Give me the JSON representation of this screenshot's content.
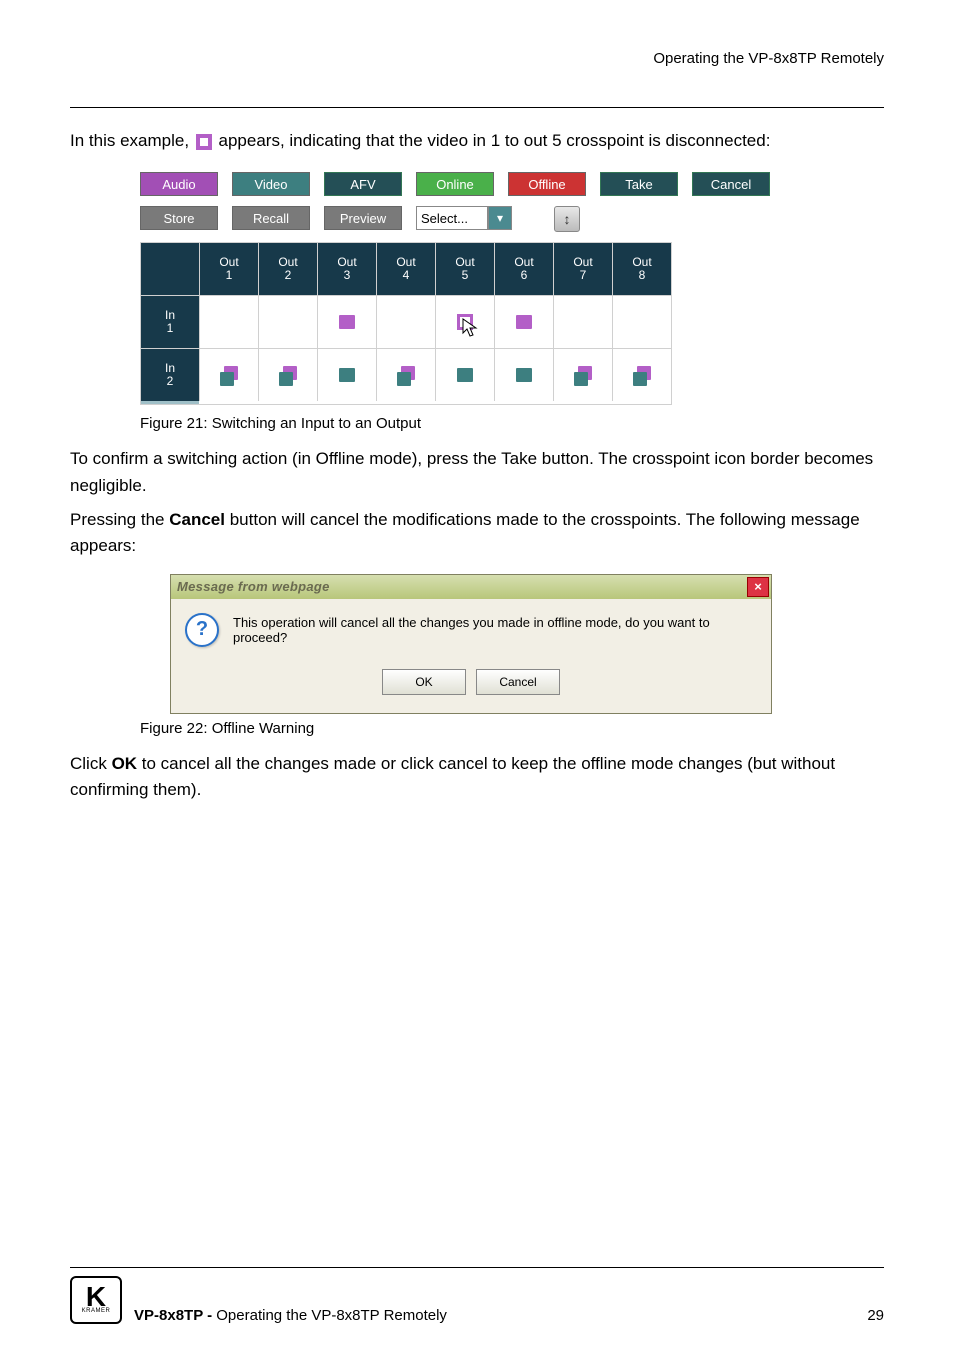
{
  "header_right": "Operating the VP-8x8TP Remotely",
  "intro": {
    "p1_pre": "In this example, ",
    "p1_post": " appears, indicating that the video in 1 to out 5 crosspoint is disconnected:"
  },
  "toolbar": {
    "row1": [
      "Audio",
      "Video",
      "AFV",
      "Online",
      "Offline",
      "Take",
      "Cancel"
    ],
    "row1_colors": [
      "purple",
      "teal",
      "dteal",
      "green",
      "red",
      "dteal",
      "dteal"
    ],
    "row2": [
      "Store",
      "Recall",
      "Preview"
    ],
    "row2_colors": [
      "grey",
      "grey",
      "grey"
    ],
    "select_label": "Select..."
  },
  "grid": {
    "cols": [
      "Out 1",
      "Out 2",
      "Out 3",
      "Out 4",
      "Out 5",
      "Out 6",
      "Out 7",
      "Out 8"
    ],
    "rows": [
      "In 1",
      "In 2"
    ],
    "cells": [
      [
        null,
        null,
        "solid-audio",
        null,
        "outline-cursor",
        "solid-audio",
        null,
        null
      ],
      [
        "both",
        "both",
        "solid-video",
        "both",
        "solid-video",
        "solid-video",
        "both",
        "both"
      ]
    ]
  },
  "caption1": "Figure 21: Switching an Input to an Output",
  "para2": "To confirm a switching action (in Offline mode), press the Take button. The crosspoint icon border becomes negligible.",
  "para3_a": "Pressing the ",
  "para3_bold": "Cancel",
  "para3_b": " button will cancel the modifications made to the crosspoints. The following message appears:",
  "dialog": {
    "title": "Message from webpage",
    "message": "This operation will cancel all the changes you made in offline mode, do you want to proceed?",
    "ok": "OK",
    "cancel": "Cancel"
  },
  "caption2": "Figure 22: Offline Warning",
  "para4_a": "Click ",
  "para4_bold": "OK",
  "para4_b": " to cancel all the changes made or click cancel to keep the offline mode changes (but without confirming them).",
  "footer": {
    "left_prefix": "VP-8x8TP - ",
    "left_rest": "Operating the VP-8x8TP Remotely",
    "page": "29",
    "logo_sub": "KRAMER"
  }
}
